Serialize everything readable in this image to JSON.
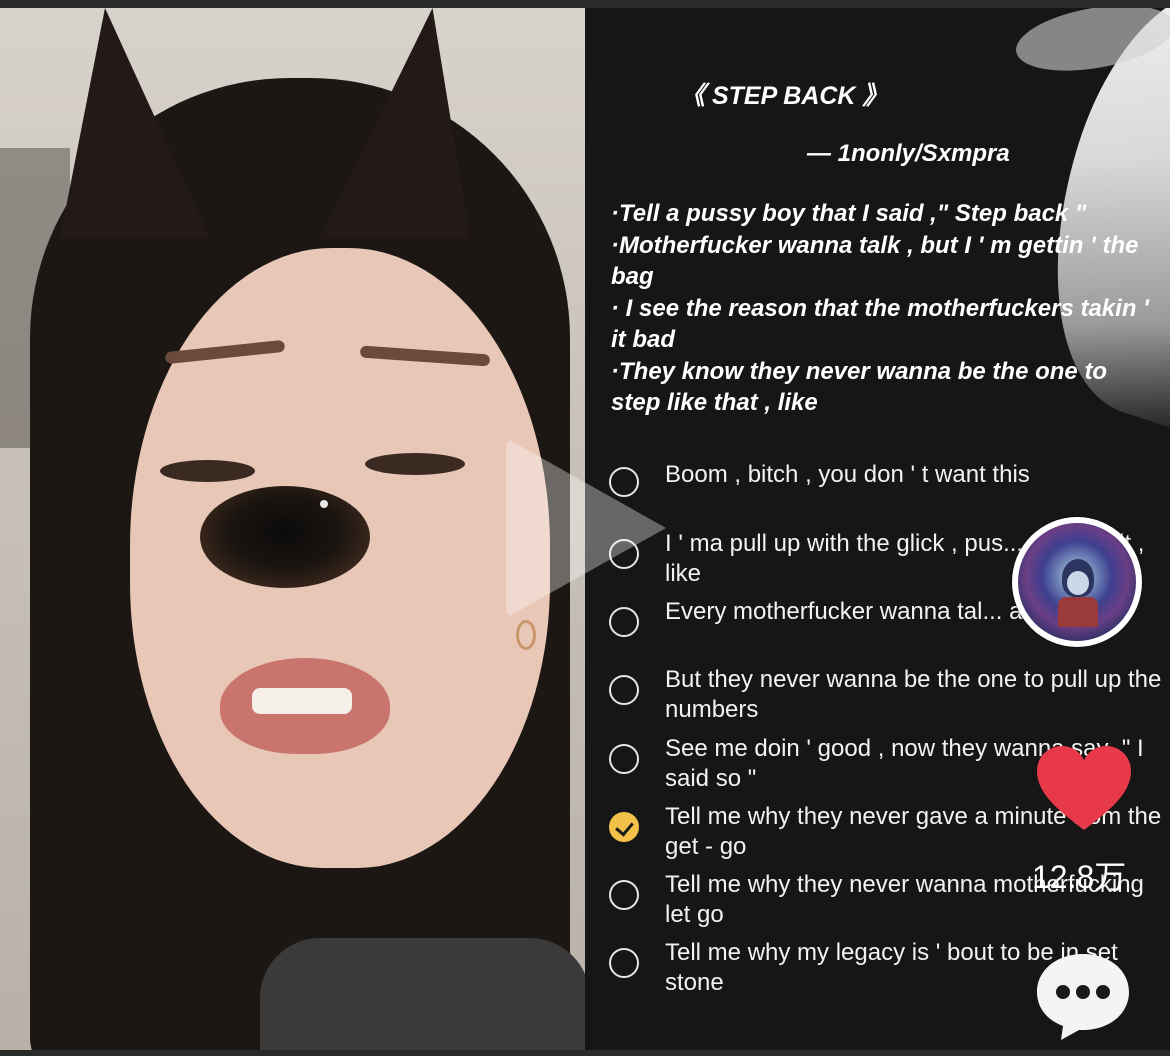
{
  "lyrics": {
    "title": "《 STEP BACK 》",
    "artist": "— 1nonly/Sxmpra",
    "verse": [
      "·Tell a pussy boy that I said ,\" Step back \"",
      "·Motherfucker wanna talk , but I ' m gettin ' the bag",
      "· I see the reason that the motherfuckers takin ' it bad",
      "·They know they never wanna be the one to step like that , like"
    ],
    "options": [
      {
        "text": "Boom , bitch , you don ' t want this",
        "checked": false
      },
      {
        "text": "I ' ma pull up with the glick , pus... a talk shit , like",
        "checked": false
      },
      {
        "text": "Every motherfucker wanna tal... another",
        "checked": false
      },
      {
        "text": "But they never wanna be the one to pull up the numbers",
        "checked": false
      },
      {
        "text": "See me doin ' good , now they wanna say ,\" I said so \"",
        "checked": false
      },
      {
        "text": "Tell me why they never gave a minute from the get - go",
        "checked": true
      },
      {
        "text": "Tell me why they never wanna motherfucking let go",
        "checked": false
      },
      {
        "text": "Tell me why my legacy is ' bout to be in set stone",
        "checked": false
      }
    ]
  },
  "actions": {
    "like_count": "12.8万",
    "heart_color": "#e8394b",
    "accent_check": "#f3c04a",
    "icons": [
      "avatar",
      "heart-icon",
      "comment-icon",
      "play-icon"
    ]
  }
}
